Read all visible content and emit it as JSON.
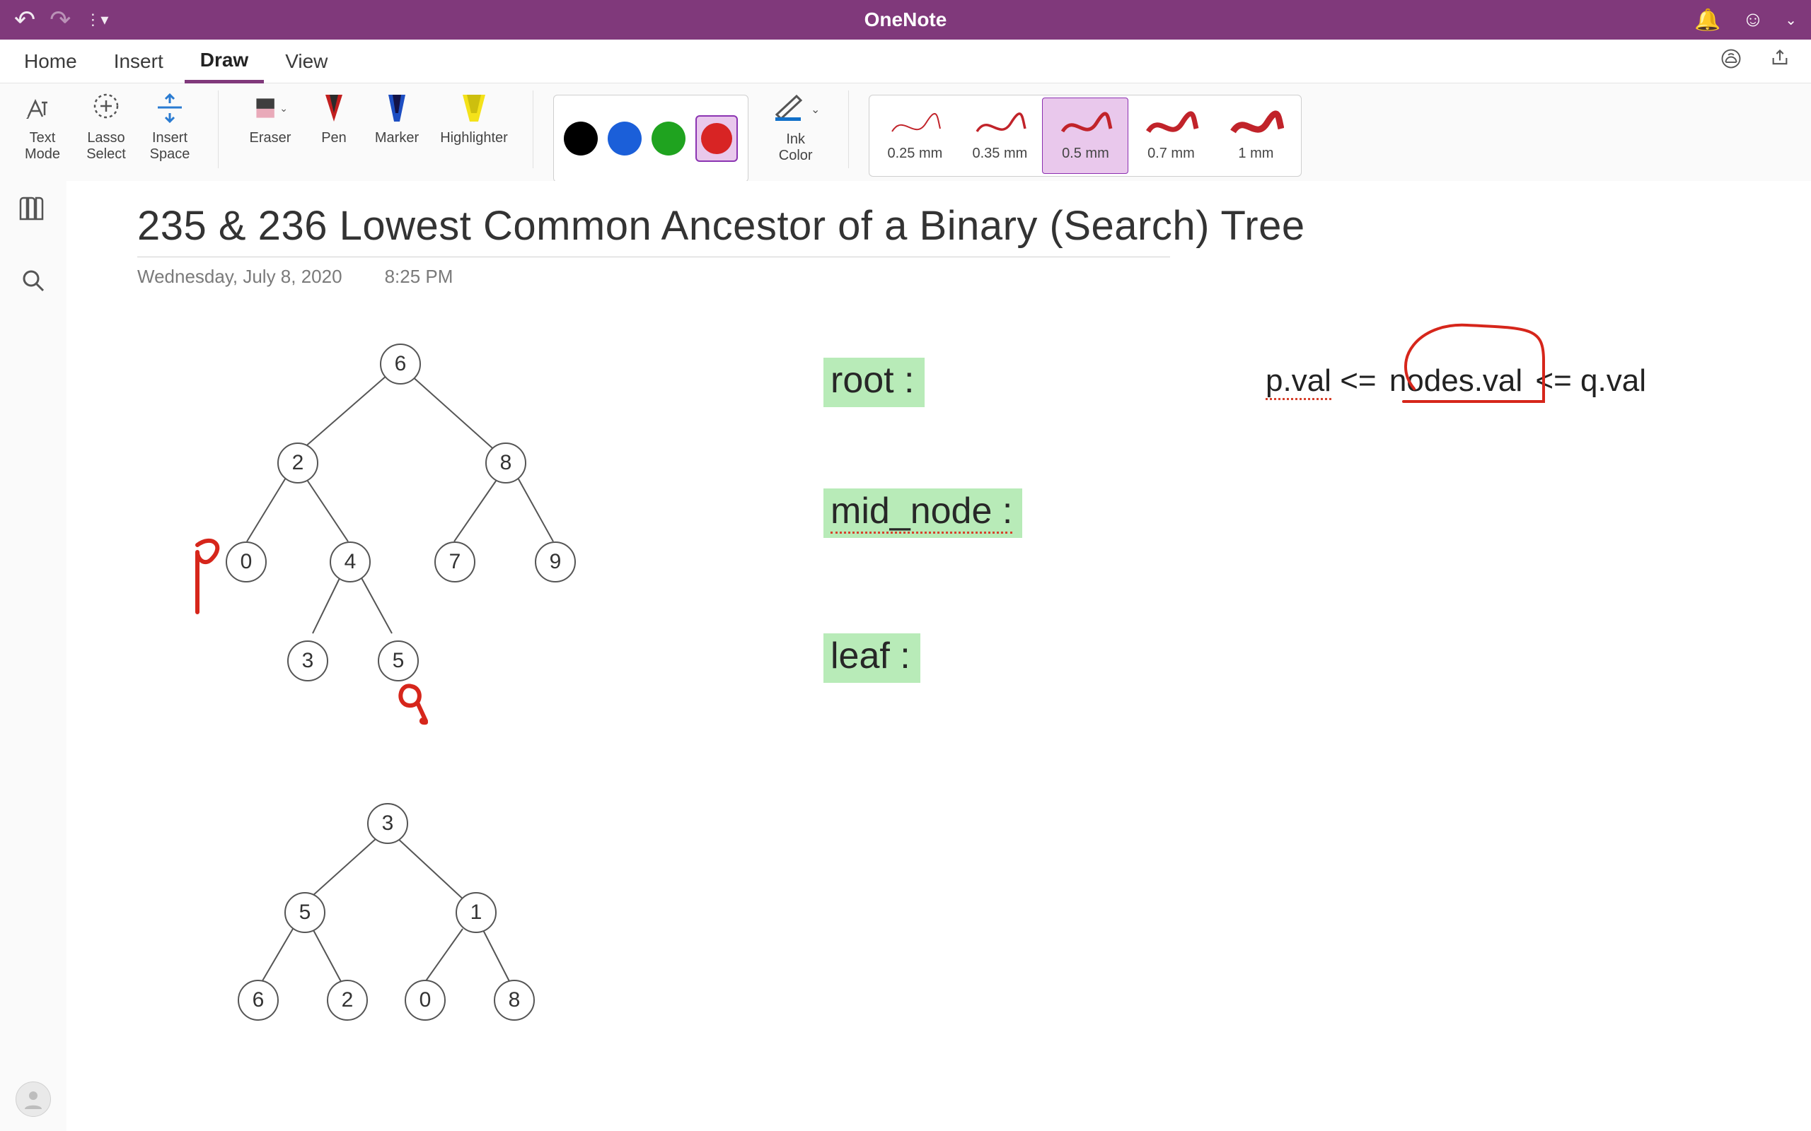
{
  "app": {
    "title": "OneNote"
  },
  "tabs": {
    "items": [
      {
        "label": "Home"
      },
      {
        "label": "Insert"
      },
      {
        "label": "Draw"
      },
      {
        "label": "View"
      }
    ],
    "active_index": 2
  },
  "ribbon": {
    "mode_tools": {
      "text_mode": {
        "line1": "Text",
        "line2": "Mode"
      },
      "lasso_select": {
        "line1": "Lasso",
        "line2": "Select"
      },
      "insert_space": {
        "line1": "Insert",
        "line2": "Space"
      }
    },
    "pen_tools": {
      "eraser": {
        "label": "Eraser"
      },
      "pen": {
        "label": "Pen"
      },
      "marker": {
        "label": "Marker"
      },
      "highlighter": {
        "label": "Highlighter"
      }
    },
    "ink_swatches": {
      "colors": [
        "#000000",
        "#1b5fd9",
        "#1fa31f",
        "#d82424"
      ],
      "selected_index": 3
    },
    "ink_color": {
      "line1": "Ink",
      "line2": "Color"
    },
    "strokes": {
      "items": [
        {
          "label": "0.25 mm"
        },
        {
          "label": "0.35 mm"
        },
        {
          "label": "0.5 mm"
        },
        {
          "label": "0.7 mm"
        },
        {
          "label": "1 mm"
        }
      ],
      "selected_index": 2,
      "stroke_color": "#c1232a"
    }
  },
  "page": {
    "title": "235 & 236 Lowest Common Ancestor of a Binary (Search) Tree",
    "date": "Wednesday, July 8, 2020",
    "time": "8:25 PM"
  },
  "tree1": {
    "nodes": {
      "n6": "6",
      "n2": "2",
      "n8": "8",
      "n0": "0",
      "n4": "4",
      "n7": "7",
      "n9": "9",
      "n3": "3",
      "n5": "5"
    }
  },
  "tree2": {
    "nodes": {
      "n3": "3",
      "n5": "5",
      "n1": "1",
      "n6": "6",
      "n2": "2",
      "n0": "0",
      "n8": "8"
    }
  },
  "labels": {
    "root": "root :",
    "mid": "mid_node :",
    "leaf": "leaf :"
  },
  "formula": {
    "p1": "p.val",
    "p2": " <=",
    "p3": "nodes.val",
    "p4": "<= q.val"
  }
}
